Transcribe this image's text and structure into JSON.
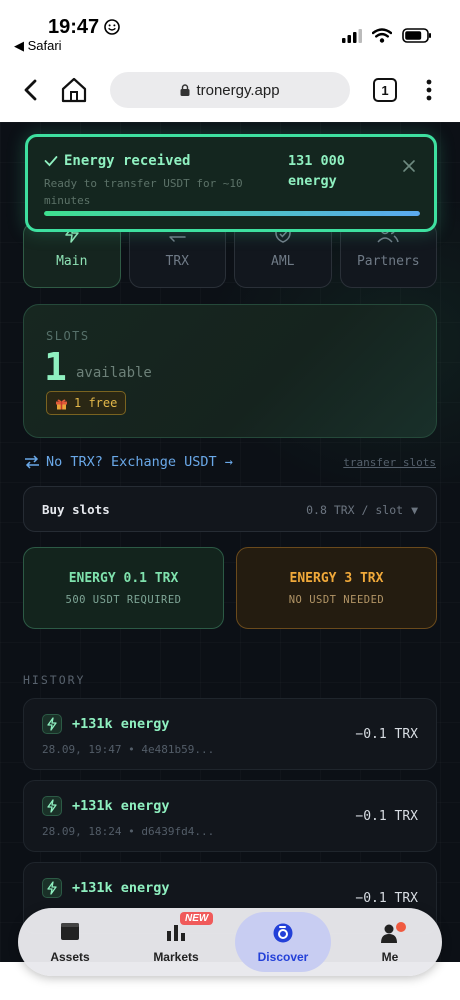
{
  "status_bar": {
    "time": "19:47",
    "back_app": "Safari"
  },
  "browser": {
    "url": "tronergy.app",
    "tab_count": "1"
  },
  "toast": {
    "title": "Energy received",
    "subtitle": "Ready to transfer USDT for ~10 minutes",
    "amount": "131 000 energy",
    "progress": 1.0
  },
  "nav_tabs": [
    {
      "label": "Main",
      "icon": "bolt-icon"
    },
    {
      "label": "TRX",
      "icon": "exchange-icon"
    },
    {
      "label": "AML",
      "icon": "shield-check-icon"
    },
    {
      "label": "Partners",
      "icon": "users-icon"
    }
  ],
  "slots": {
    "label": "SLOTS",
    "count": "1",
    "available_label": "available",
    "free_badge": "1 free"
  },
  "exchange": {
    "link_text": "No TRX? Exchange USDT →",
    "transfer_slots": "transfer slots"
  },
  "buy": {
    "label": "Buy slots",
    "price": "0.8 TRX / slot",
    "caret": "▼"
  },
  "energy_options": [
    {
      "title": "ENERGY 0.1 TRX",
      "subtitle": "500 USDT REQUIRED",
      "color": "#7fe2ad"
    },
    {
      "title": "ENERGY 3 TRX",
      "subtitle": "NO USDT NEEDED",
      "color": "#f0a93a"
    }
  ],
  "history": {
    "title": "HISTORY",
    "items": [
      {
        "amount": "+131k energy",
        "meta": "28.09, 19:47 • 4e481b59...",
        "cost": "−0.1 TRX"
      },
      {
        "amount": "+131k energy",
        "meta": "28.09, 18:24 • d6439fd4...",
        "cost": "−0.1 TRX"
      },
      {
        "amount": "+131k energy",
        "meta": "",
        "cost": "−0.1 TRX"
      }
    ]
  },
  "tab_bar": {
    "items": [
      {
        "label": "Assets",
        "icon": "wallet-icon"
      },
      {
        "label": "Markets",
        "icon": "bar-chart-icon",
        "badge": "NEW"
      },
      {
        "label": "Discover",
        "icon": "discover-icon"
      },
      {
        "label": "Me",
        "icon": "person-icon"
      }
    ]
  },
  "colors": {
    "accent_green": "#8ff0c0",
    "toast_border": "#3ee0a0",
    "link_blue": "#6aa8e8",
    "background": "#0c1016"
  }
}
